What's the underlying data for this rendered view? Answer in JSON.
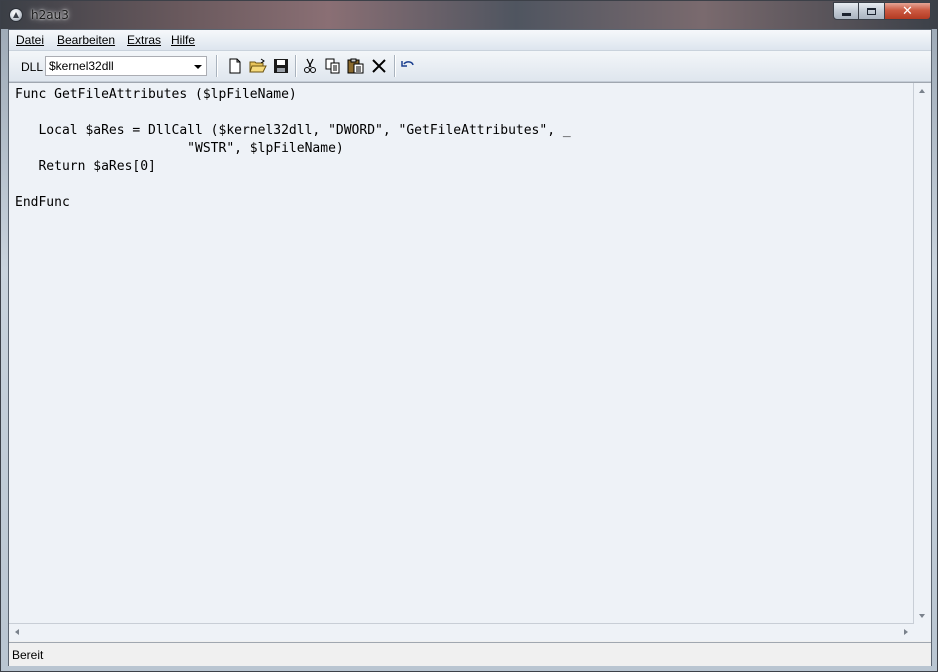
{
  "window": {
    "title": "h2au3"
  },
  "menubar": {
    "items": [
      {
        "label": "Datei"
      },
      {
        "label": "Bearbeiten"
      },
      {
        "label": "Extras"
      },
      {
        "label": "Hilfe"
      }
    ]
  },
  "toolbar": {
    "dll_label": "DLL",
    "dll_selected": "$kernel32dll",
    "buttons": [
      {
        "icon": "new-file-icon"
      },
      {
        "icon": "open-folder-icon"
      },
      {
        "icon": "save-icon"
      },
      {
        "icon": "cut-icon"
      },
      {
        "icon": "copy-icon"
      },
      {
        "icon": "paste-icon"
      },
      {
        "icon": "delete-icon"
      },
      {
        "icon": "undo-icon"
      }
    ]
  },
  "editor": {
    "code": "Func GetFileAttributes ($lpFileName)\n\n   Local $aRes = DllCall ($kernel32dll, \"DWORD\", \"GetFileAttributes\", _\n                      \"WSTR\", $lpFileName)\n   Return $aRes[0]\n\nEndFunc"
  },
  "statusbar": {
    "text": "Bereit"
  }
}
